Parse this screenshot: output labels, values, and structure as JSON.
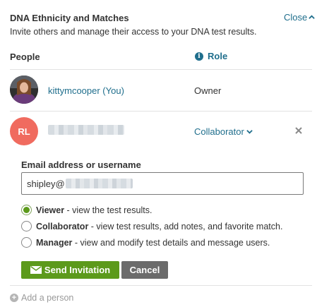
{
  "header": {
    "title": "DNA Ethnicity and Matches",
    "close_label": "Close",
    "subtitle": "Invite others and manage their access to your DNA test results."
  },
  "table": {
    "col_people": "People",
    "col_role": "Role",
    "info_glyph": "i"
  },
  "members": [
    {
      "name": "kittymcooper (You)",
      "role": "Owner"
    },
    {
      "initials": "RL",
      "role": "Collaborator"
    }
  ],
  "invite": {
    "field_label": "Email address or username",
    "email_value": "shipley@",
    "options": [
      {
        "name": "Viewer",
        "desc": " - view the test results.",
        "selected": true
      },
      {
        "name": "Collaborator",
        "desc": " - view test results, add notes, and favorite match.",
        "selected": false
      },
      {
        "name": "Manager",
        "desc": " - view and modify test details and message users.",
        "selected": false
      }
    ],
    "send_label": "Send Invitation",
    "cancel_label": "Cancel"
  },
  "footer": {
    "add_person_label": "Add a person",
    "plus_glyph": "+"
  },
  "colors": {
    "link": "#1f6e8c",
    "primary_green": "#5c9a1b",
    "cancel_gray": "#6b6b6b",
    "avatar_red": "#f06b5f"
  },
  "icons": {
    "close": "chevron-up-icon",
    "role_info": "info-icon",
    "role_menu": "chevron-down-icon",
    "remove": "close-icon",
    "send": "envelope-icon",
    "add": "plus-circle-icon"
  }
}
